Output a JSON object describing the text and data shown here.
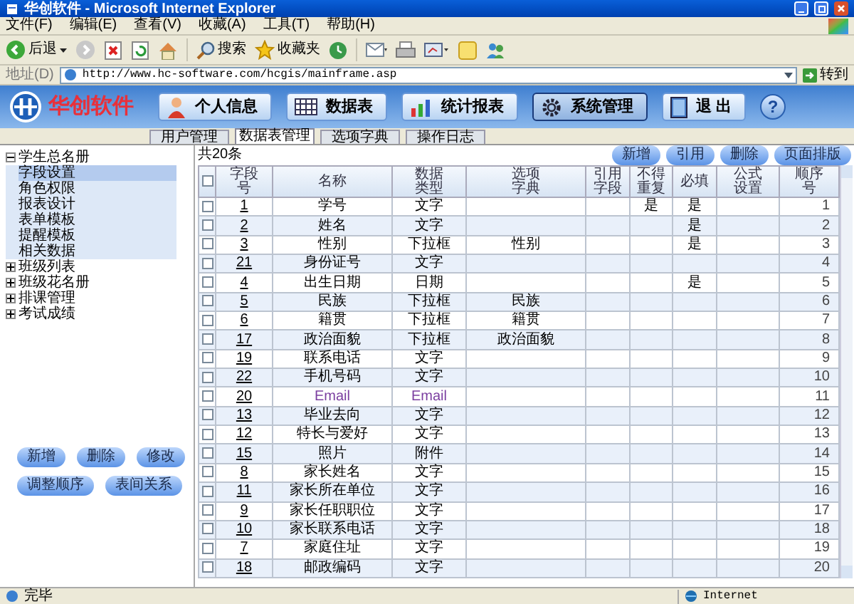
{
  "window": {
    "title": "华创软件 - Microsoft Internet Explorer"
  },
  "menu": [
    "文件(F)",
    "编辑(E)",
    "查看(V)",
    "收藏(A)",
    "工具(T)",
    "帮助(H)"
  ],
  "toolbar": {
    "back": "后退",
    "search": "搜索",
    "favorites": "收藏夹"
  },
  "address": {
    "label": "地址(D)",
    "url": "http://www.hc-software.com/hcgis/mainframe.asp",
    "go": "转到"
  },
  "app": {
    "logo": "华创软件",
    "help": "?",
    "nav": [
      {
        "label": "个人信息",
        "selected": false,
        "kind": "person"
      },
      {
        "label": "数据表",
        "selected": false,
        "kind": "grid"
      },
      {
        "label": "统计报表",
        "selected": false,
        "kind": "chart"
      },
      {
        "label": "系统管理",
        "selected": true,
        "kind": "gear"
      },
      {
        "label": "退 出",
        "selected": false,
        "kind": "exit"
      }
    ]
  },
  "tabs": [
    {
      "label": "用户管理",
      "selected": false
    },
    {
      "label": "数据表管理",
      "selected": true
    },
    {
      "label": "选项字典",
      "selected": false
    },
    {
      "label": "操作日志",
      "selected": false
    }
  ],
  "tree": [
    {
      "label": "学生总名册",
      "expanded": true,
      "children": [
        {
          "label": "字段设置",
          "selected": true
        },
        {
          "label": "角色权限",
          "selected": false
        },
        {
          "label": "报表设计",
          "selected": false
        },
        {
          "label": "表单模板",
          "selected": false
        },
        {
          "label": "提醒模板",
          "selected": false
        },
        {
          "label": "相关数据",
          "selected": false
        }
      ]
    },
    {
      "label": "班级列表",
      "expanded": false
    },
    {
      "label": "班级花名册",
      "expanded": false
    },
    {
      "label": "排课管理",
      "expanded": false
    },
    {
      "label": "考试成绩",
      "expanded": false
    }
  ],
  "left_buttons": [
    [
      "新增",
      "删除",
      "修改"
    ],
    [
      "调整顺序",
      "表间关系"
    ]
  ],
  "count": "共20条",
  "actions": [
    "新增",
    "引用",
    "删除",
    "页面排版"
  ],
  "table": {
    "header_checked": false,
    "columns": [
      "字段号",
      "名称",
      "数据类型",
      "选项字典",
      "引用字段",
      "不得重复",
      "必填",
      "公式设置",
      "顺序号"
    ],
    "rows": [
      {
        "checked": false,
        "id": "1",
        "name": "学号",
        "type": "文字",
        "unique": "是",
        "required": "是",
        "order": "1",
        "color": "#000000"
      },
      {
        "checked": false,
        "id": "2",
        "name": "姓名",
        "type": "文字",
        "required": "是",
        "order": "2",
        "color": "#000000"
      },
      {
        "checked": false,
        "id": "3",
        "name": "性别",
        "type": "下拉框",
        "dict": "性别",
        "required": "是",
        "order": "3",
        "color": "#000000"
      },
      {
        "checked": false,
        "id": "21",
        "name": "身份证号",
        "type": "文字",
        "order": "4",
        "color": "#000000"
      },
      {
        "checked": false,
        "id": "4",
        "name": "出生日期",
        "type": "日期",
        "required": "是",
        "order": "5",
        "color": "#000000"
      },
      {
        "checked": false,
        "id": "5",
        "name": "民族",
        "type": "下拉框",
        "dict": "民族",
        "order": "6",
        "color": "#000000"
      },
      {
        "checked": false,
        "id": "6",
        "name": "籍贯",
        "type": "下拉框",
        "dict": "籍贯",
        "order": "7",
        "color": "#000000"
      },
      {
        "checked": false,
        "id": "17",
        "name": "政治面貌",
        "type": "下拉框",
        "dict": "政治面貌",
        "order": "8",
        "color": "#000000"
      },
      {
        "checked": false,
        "id": "19",
        "name": "联系电话",
        "type": "文字",
        "order": "9",
        "color": "#000000"
      },
      {
        "checked": false,
        "id": "22",
        "name": "手机号码",
        "type": "文字",
        "order": "10",
        "color": "#000000"
      },
      {
        "checked": false,
        "id": "20",
        "name": "Email",
        "type": "Email",
        "order": "11",
        "color": "#7b3fa0"
      },
      {
        "checked": false,
        "id": "13",
        "name": "毕业去向",
        "type": "文字",
        "order": "12",
        "color": "#000000"
      },
      {
        "checked": false,
        "id": "12",
        "name": "特长与爱好",
        "type": "文字",
        "order": "13",
        "color": "#000000"
      },
      {
        "checked": false,
        "id": "15",
        "name": "照片",
        "type": "附件",
        "order": "14",
        "color": "#000000"
      },
      {
        "checked": false,
        "id": "8",
        "name": "家长姓名",
        "type": "文字",
        "order": "15",
        "color": "#000000"
      },
      {
        "checked": false,
        "id": "11",
        "name": "家长所在单位",
        "type": "文字",
        "order": "16",
        "color": "#000000"
      },
      {
        "checked": false,
        "id": "9",
        "name": "家长任职职位",
        "type": "文字",
        "order": "17",
        "color": "#000000"
      },
      {
        "checked": false,
        "id": "10",
        "name": "家长联系电话",
        "type": "文字",
        "order": "18",
        "color": "#000000"
      },
      {
        "checked": false,
        "id": "7",
        "name": "家庭住址",
        "type": "文字",
        "order": "19",
        "color": "#000000"
      },
      {
        "checked": false,
        "id": "18",
        "name": "邮政编码",
        "type": "文字",
        "order": "20",
        "color": "#000000"
      }
    ]
  },
  "status": {
    "text": "完毕",
    "zone": "Internet"
  }
}
